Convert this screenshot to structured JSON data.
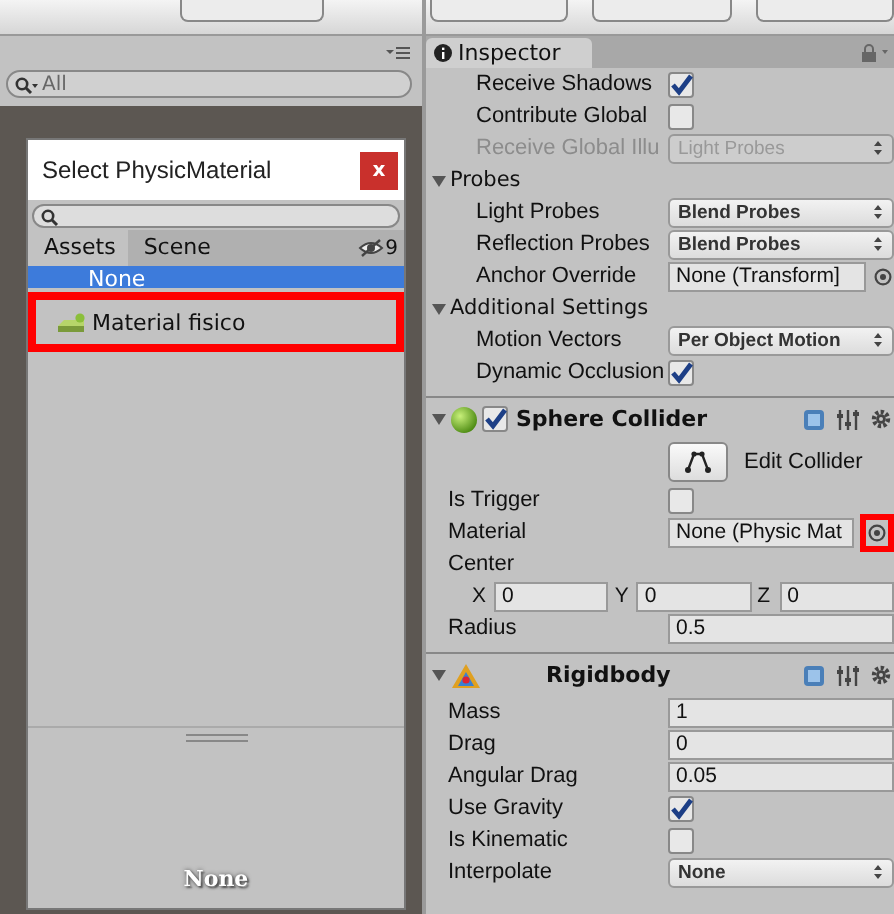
{
  "project": {
    "search": {
      "placeholder": "All"
    }
  },
  "picker": {
    "title": "Select PhysicMaterial",
    "close": "x",
    "tabs": [
      {
        "label": "Assets",
        "selected": true
      },
      {
        "label": "Scene",
        "selected": false
      }
    ],
    "hidden_count": "9",
    "items": [
      {
        "label": "None",
        "selected": true,
        "highlighted": false
      },
      {
        "label": "Material fisico",
        "selected": false,
        "highlighted": true
      }
    ],
    "preview": "None"
  },
  "inspector": {
    "tab": "Inspector",
    "sections": [
      {
        "kind": "plain",
        "rows": [
          {
            "kind": "checkbox",
            "label": "Receive Shadows",
            "checked": true
          },
          {
            "kind": "checkbox",
            "label": "Contribute Global",
            "checked": false
          },
          {
            "kind": "dropdown",
            "label": "Receive Global Illu",
            "value": "Light Probes",
            "disabled": true
          }
        ]
      },
      {
        "kind": "foldout",
        "title": "Probes",
        "expanded": true,
        "rows": [
          {
            "kind": "dropdown",
            "label": "Light Probes",
            "value": "Blend Probes",
            "disabled": false
          },
          {
            "kind": "dropdown",
            "label": "Reflection Probes",
            "value": "Blend Probes",
            "disabled": false
          },
          {
            "kind": "object",
            "label": "Anchor Override",
            "value": "None (Transform]",
            "highlighted": false
          }
        ]
      },
      {
        "kind": "foldout",
        "title": "Additional Settings",
        "expanded": true,
        "rows": [
          {
            "kind": "dropdown",
            "label": "Motion Vectors",
            "value": "Per Object Motion",
            "disabled": false
          },
          {
            "kind": "checkbox",
            "label": "Dynamic Occlusion",
            "checked": true
          }
        ]
      },
      {
        "kind": "collider",
        "title": "Sphere Collider",
        "expanded": true,
        "enabled": true,
        "rows": [
          {
            "kind": "button",
            "label": "Edit Collider"
          },
          {
            "kind": "checkbox",
            "label": "Is Trigger",
            "checked": false
          },
          {
            "kind": "object",
            "label": "Material",
            "value": "None (Physic Mat",
            "highlighted": true
          },
          {
            "kind": "heading",
            "label": "Center"
          },
          {
            "kind": "vector",
            "axes": [
              {
                "axis": "X",
                "value": "0"
              },
              {
                "axis": "Y",
                "value": "0"
              },
              {
                "axis": "Z",
                "value": "0"
              }
            ]
          },
          {
            "kind": "number",
            "label": "Radius",
            "value": "0.5"
          }
        ]
      },
      {
        "kind": "rigidbody",
        "title": "Rigidbody",
        "expanded": true,
        "rows": [
          {
            "kind": "number",
            "label": "Mass",
            "value": "1"
          },
          {
            "kind": "number",
            "label": "Drag",
            "value": "0"
          },
          {
            "kind": "number",
            "label": "Angular Drag",
            "value": "0.05"
          },
          {
            "kind": "checkbox",
            "label": "Use Gravity",
            "checked": true
          },
          {
            "kind": "checkbox",
            "label": "Is Kinematic",
            "checked": false
          },
          {
            "kind": "dropdown",
            "label": "Interpolate",
            "value": "None",
            "disabled": false
          }
        ]
      }
    ]
  }
}
